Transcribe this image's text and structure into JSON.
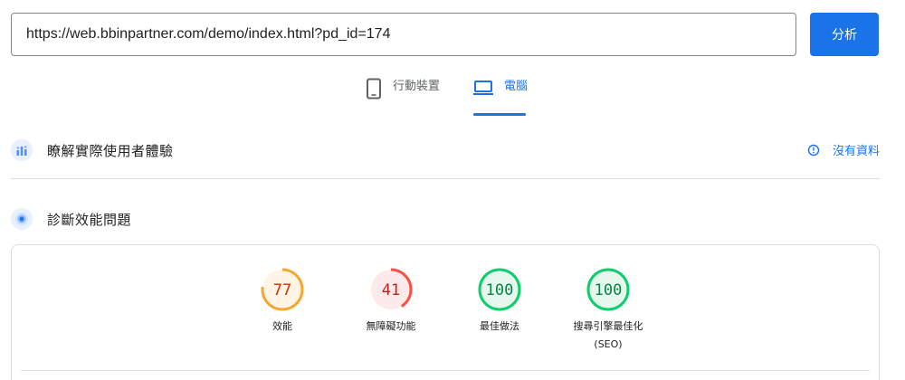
{
  "search": {
    "url_value": "https://web.bbinpartner.com/demo/index.html?pd_id=174",
    "analyze_label": "分析"
  },
  "tabs": [
    {
      "label": "行動裝置",
      "icon": "smartphone-icon",
      "selected": false
    },
    {
      "label": "電腦",
      "icon": "laptop-icon",
      "selected": true
    }
  ],
  "field_data": {
    "title": "瞭解實際使用者體驗",
    "status_text": "沒有資料",
    "status_icon": "info-icon"
  },
  "diagnose": {
    "title": "診斷效能問題"
  },
  "scores": [
    {
      "value": 77,
      "label": "效能",
      "sublabel": "",
      "color": "#f4a833",
      "bg": "#fff4e5",
      "text_color": "#c33300"
    },
    {
      "value": 41,
      "label": "無障礙功能",
      "sublabel": "",
      "color": "#ff4e42",
      "bg": "#fdeaea",
      "text_color": "#c5221f"
    },
    {
      "value": 100,
      "label": "最佳做法",
      "sublabel": "",
      "color": "#0cce6b",
      "bg": "#e6f7ee",
      "text_color": "#018642"
    },
    {
      "value": 100,
      "label": "搜尋引擎最佳化",
      "sublabel": "(SEO)",
      "color": "#0cce6b",
      "bg": "#e6f7ee",
      "text_color": "#018642"
    }
  ],
  "colors": {
    "accent": "#1a73e8",
    "border": "#dadce0"
  }
}
